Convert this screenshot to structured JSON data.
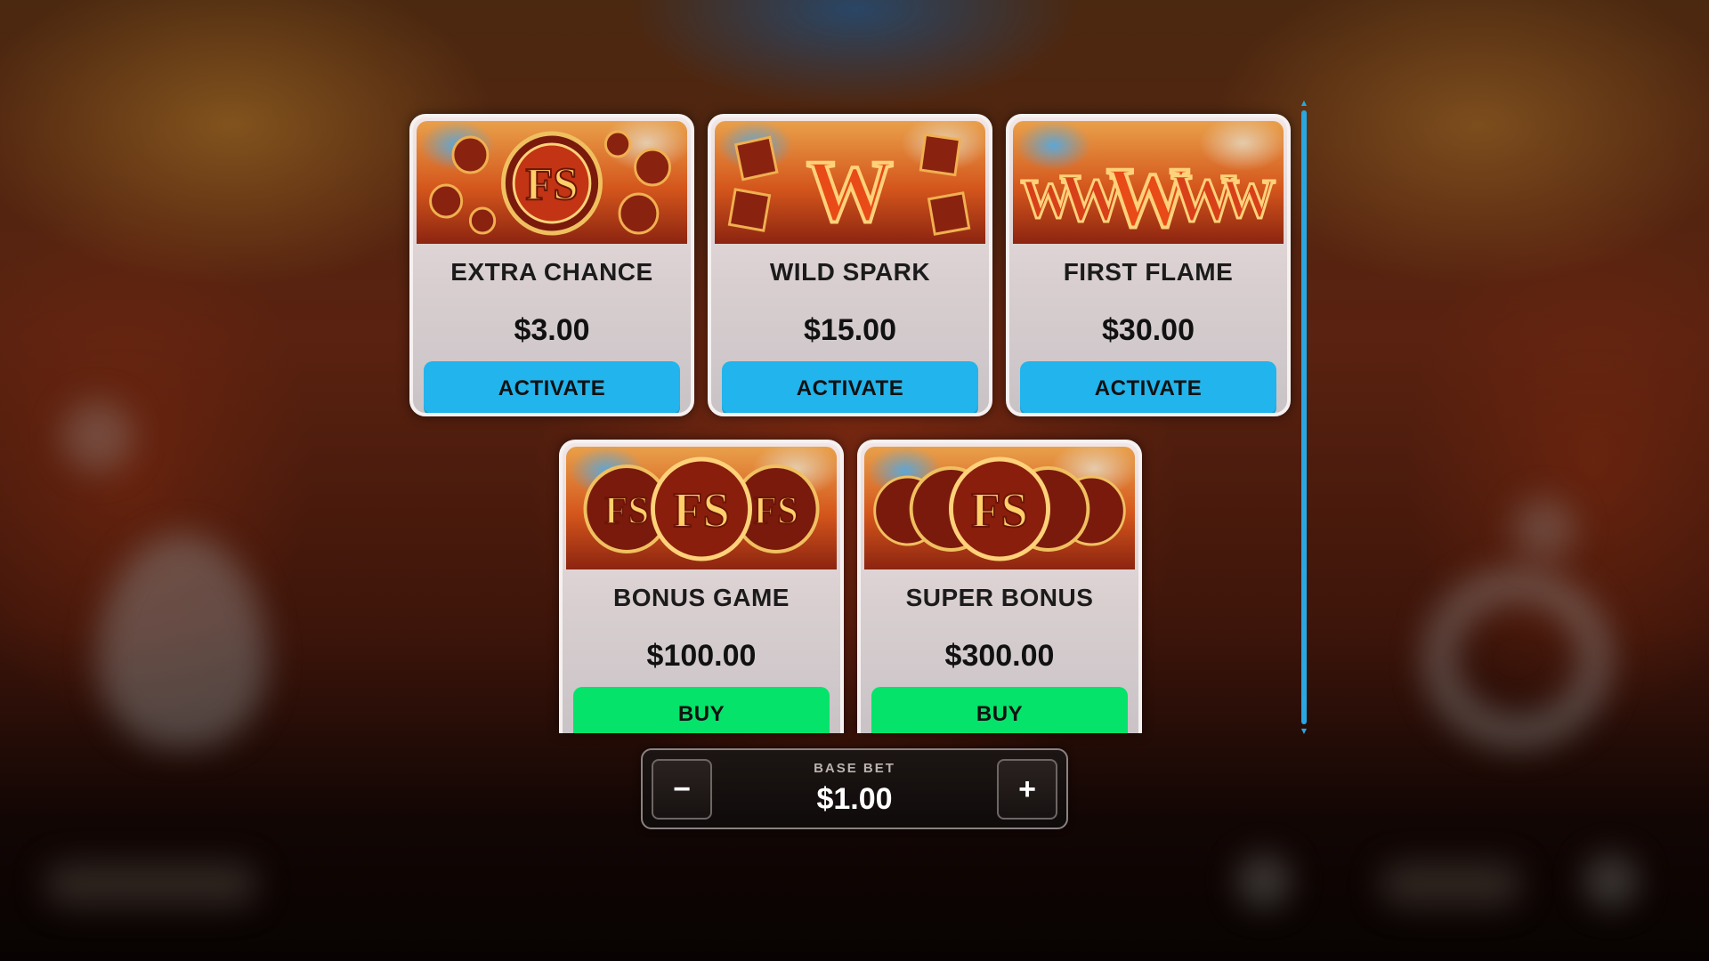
{
  "cards": [
    {
      "title": "EXTRA CHANCE",
      "price": "$3.00",
      "button": "ACTIVATE",
      "art_icon": "fs-scatter-symbol",
      "art_text": "FS"
    },
    {
      "title": "WILD SPARK",
      "price": "$15.00",
      "button": "ACTIVATE",
      "art_icon": "wild-symbol",
      "art_text": "W"
    },
    {
      "title": "FIRST FLAME",
      "price": "$30.00",
      "button": "ACTIVATE",
      "art_icon": "wild-row-symbol",
      "art_text": "W"
    },
    {
      "title": "BONUS GAME",
      "price": "$100.00",
      "button": "BUY",
      "art_icon": "triple-fs-symbol",
      "art_text": "FS"
    },
    {
      "title": "SUPER BONUS",
      "price": "$300.00",
      "button": "BUY",
      "art_icon": "super-fs-symbol",
      "art_text": "FS"
    }
  ],
  "bet": {
    "label": "BASE BET",
    "value": "$1.00",
    "minus": "−",
    "plus": "+"
  },
  "colors": {
    "activate": "#22b4ec",
    "buy": "#05e36a",
    "scrollbar": "#2aa7e0"
  }
}
